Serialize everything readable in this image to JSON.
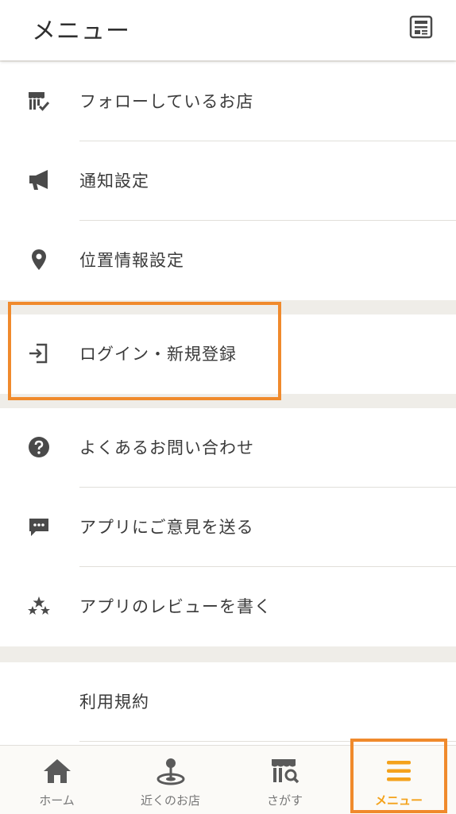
{
  "header": {
    "title": "メニュー",
    "icon": "news-icon"
  },
  "section1": [
    {
      "label": "フォローしているお店",
      "icon": "store-follow-icon"
    },
    {
      "label": "通知設定",
      "icon": "megaphone-icon"
    },
    {
      "label": "位置情報設定",
      "icon": "location-pin-icon"
    }
  ],
  "section2": [
    {
      "label": "ログイン・新規登録",
      "icon": "login-icon"
    }
  ],
  "section3": [
    {
      "label": "よくあるお問い合わせ",
      "icon": "question-icon"
    },
    {
      "label": "アプリにご意見を送る",
      "icon": "chat-icon"
    },
    {
      "label": "アプリのレビューを書く",
      "icon": "stars-icon"
    }
  ],
  "section4": [
    {
      "label": "利用規約"
    }
  ],
  "tabs": [
    {
      "label": "ホーム",
      "icon": "home-icon"
    },
    {
      "label": "近くのお店",
      "icon": "nearby-icon"
    },
    {
      "label": "さがす",
      "icon": "store-search-icon"
    },
    {
      "label": "メニュー",
      "icon": "menu-icon",
      "active": true
    }
  ],
  "colors": {
    "accent": "#f4a21b",
    "highlight": "#f08a2c",
    "icon": "#4a4a4a",
    "background": "#efede8"
  }
}
